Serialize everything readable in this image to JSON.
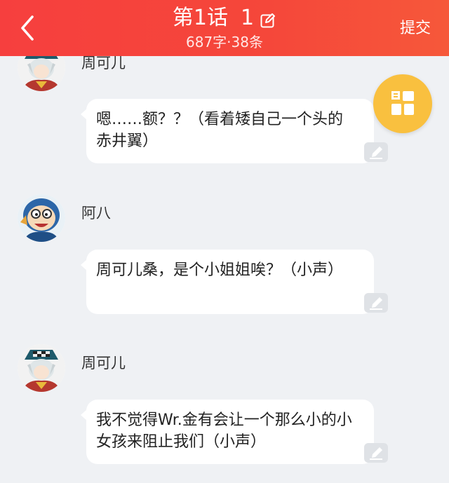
{
  "header": {
    "title": "第1话",
    "episode_number": "1",
    "subtitle": "687字·38条",
    "submit_label": "提交"
  },
  "messages": [
    {
      "name": "周可儿",
      "text": "嗯……额？？（看着矮自己一个头的赤井翼）",
      "avatar": "zhoukeer-avatar"
    },
    {
      "name": "阿八",
      "text": "周可儿桑，是个小姐姐唉？（小声）",
      "avatar": "aba-avatar"
    },
    {
      "name": "周可儿",
      "text": "我不觉得Wr.金有会让一个那么小的小女孩来阻止我们（小声）",
      "avatar": "zhoukeer-avatar"
    }
  ],
  "colors": {
    "header_red": "#f5473a",
    "fab_yellow": "#f9c03f",
    "background": "#eff1f4"
  }
}
